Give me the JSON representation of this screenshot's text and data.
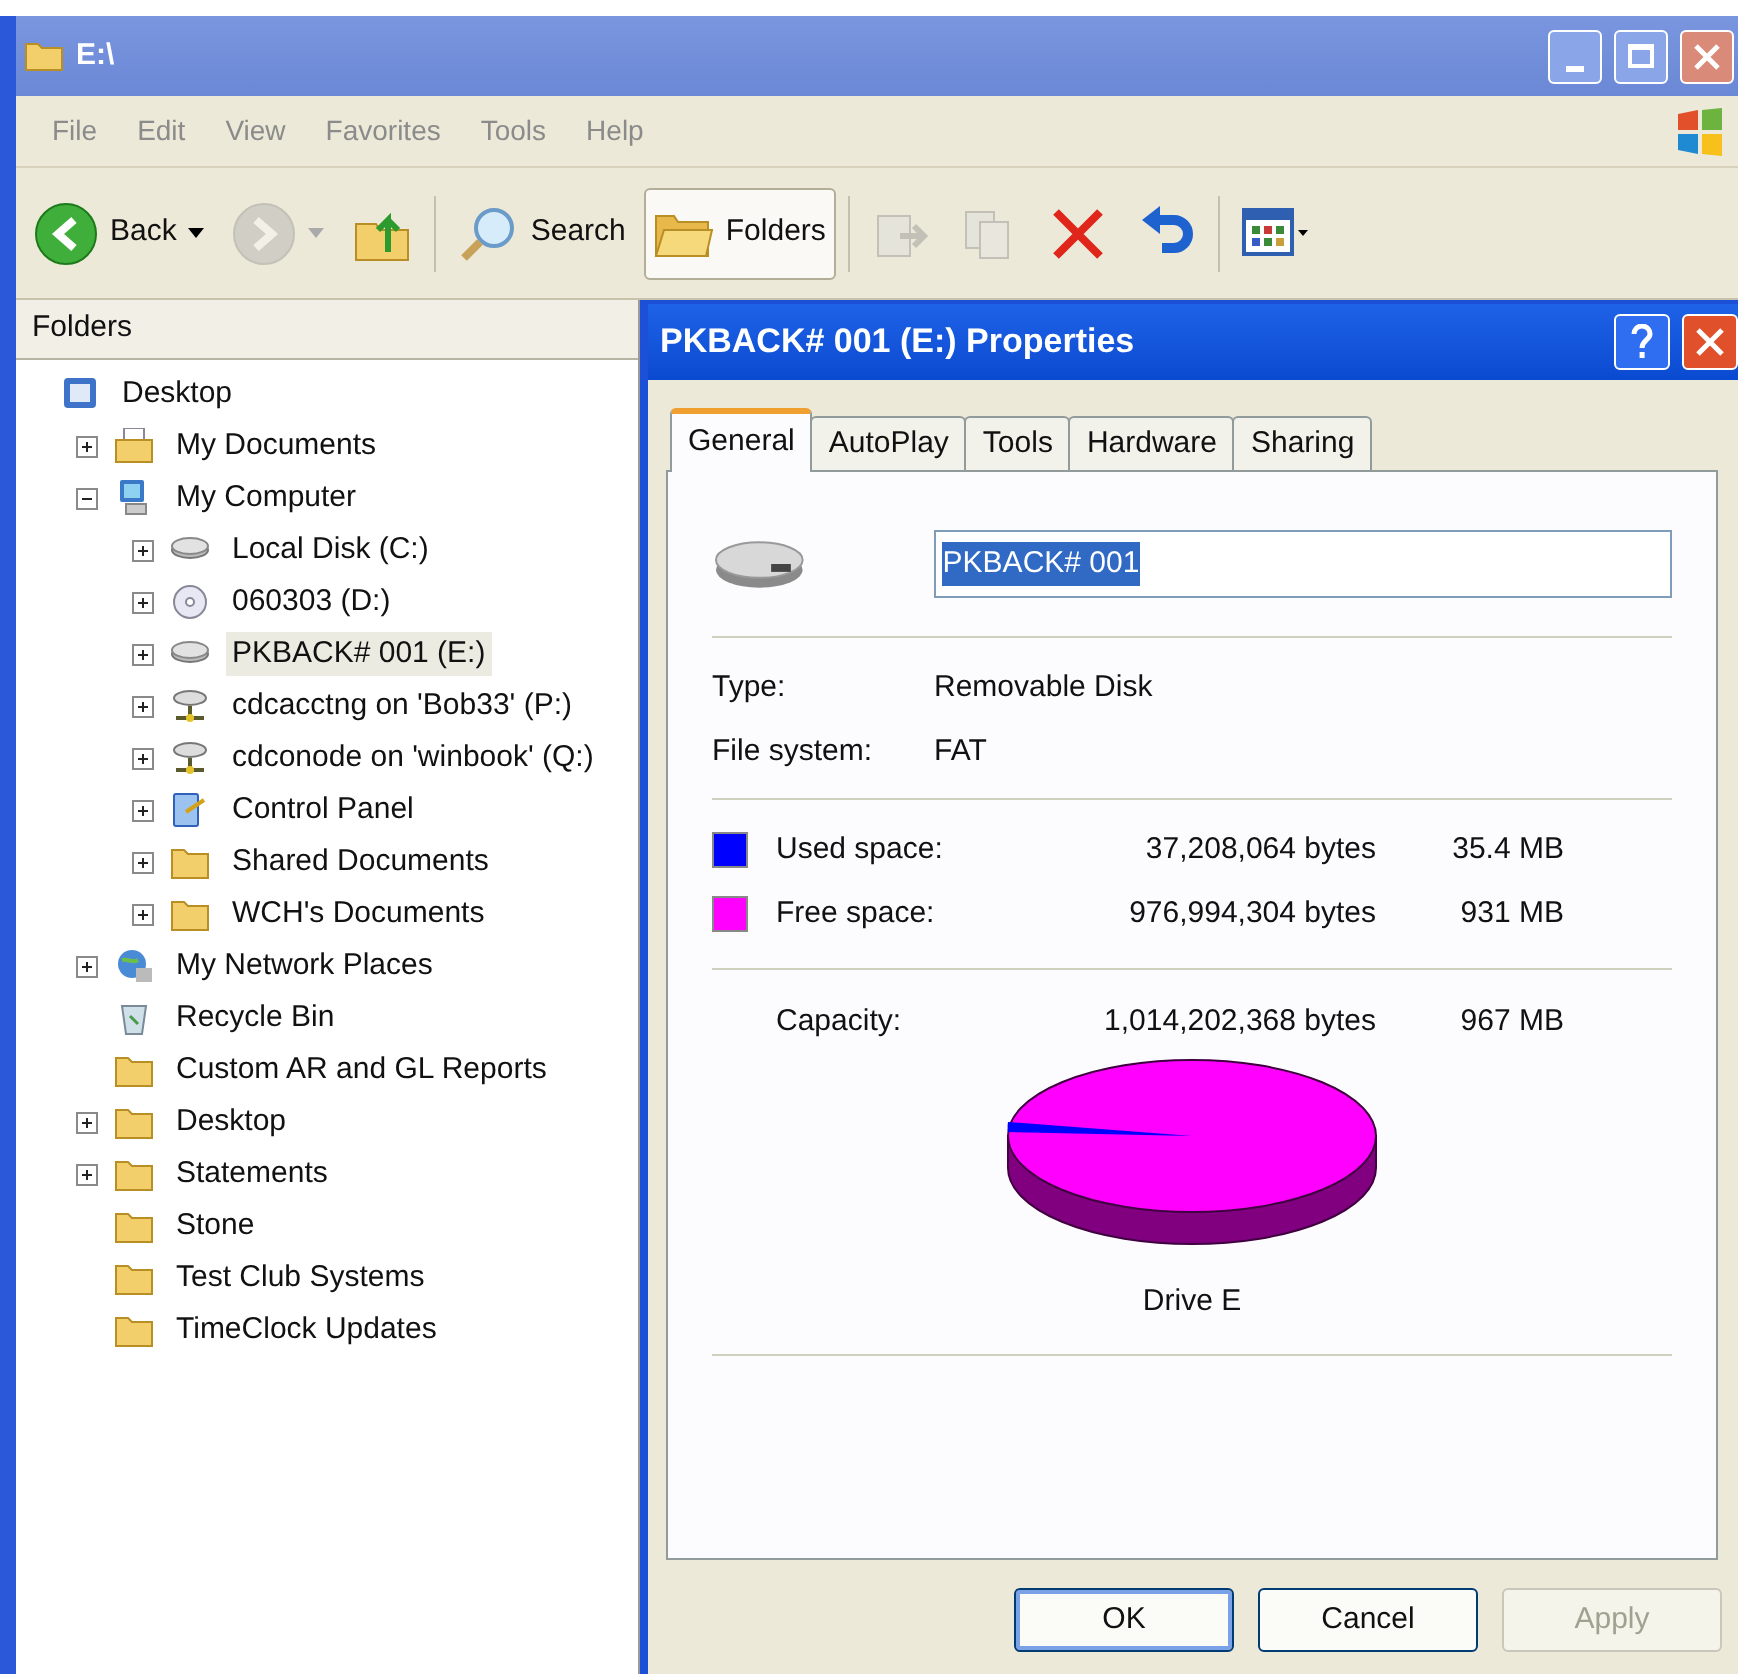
{
  "window": {
    "title": "E:\\"
  },
  "menu": [
    "File",
    "Edit",
    "View",
    "Favorites",
    "Tools",
    "Help"
  ],
  "toolbar": [
    {
      "kind": "back",
      "label": "Back",
      "disabled": false,
      "selected": false
    },
    {
      "kind": "forward",
      "disabled": true,
      "selected": false
    },
    {
      "kind": "up",
      "disabled": false,
      "selected": false
    },
    {
      "kind": "search",
      "label": "Search",
      "disabled": false,
      "selected": false
    },
    {
      "kind": "folders",
      "label": "Folders",
      "disabled": false,
      "selected": true
    },
    {
      "kind": "moveto",
      "disabled": true,
      "selected": false
    },
    {
      "kind": "copyto",
      "disabled": true,
      "selected": false
    },
    {
      "kind": "delete",
      "disabled": false,
      "selected": false
    },
    {
      "kind": "undo",
      "disabled": false,
      "selected": false
    },
    {
      "kind": "views",
      "disabled": false,
      "selected": false
    }
  ],
  "folders_pane": {
    "title": "Folders",
    "tree": [
      {
        "label": "Desktop",
        "kind": "desktop",
        "selected": false,
        "children": [
          {
            "label": "My Documents",
            "kind": "documents",
            "expanded": false,
            "selected": false
          },
          {
            "label": "My Computer",
            "kind": "computer",
            "expanded": true,
            "selected": false,
            "children": [
              {
                "label": "Local Disk (C:)",
                "kind": "drive",
                "expanded": false,
                "selected": false
              },
              {
                "label": "060303 (D:)",
                "kind": "cd",
                "expanded": false,
                "selected": false
              },
              {
                "label": "PKBACK# 001 (E:)",
                "kind": "drive",
                "expanded": false,
                "selected": true
              },
              {
                "label": "cdcacctng on 'Bob33' (P:)",
                "kind": "netdrive",
                "expanded": false,
                "selected": false
              },
              {
                "label": "cdconode on 'winbook' (Q:)",
                "kind": "netdrive",
                "expanded": false,
                "selected": false
              },
              {
                "label": "Control Panel",
                "kind": "control",
                "expanded": false,
                "selected": false
              },
              {
                "label": "Shared Documents",
                "kind": "folder",
                "expanded": false,
                "selected": false
              },
              {
                "label": "WCH's Documents",
                "kind": "folder",
                "expanded": false,
                "selected": false
              }
            ]
          },
          {
            "label": "My Network Places",
            "kind": "network",
            "expanded": false,
            "selected": false
          },
          {
            "label": "Recycle Bin",
            "kind": "recycle",
            "selected": false
          },
          {
            "label": "Custom AR and GL Reports",
            "kind": "folder",
            "selected": false
          },
          {
            "label": "Desktop",
            "kind": "folder",
            "expanded": false,
            "selected": false
          },
          {
            "label": "Statements",
            "kind": "folder",
            "expanded": false,
            "selected": false
          },
          {
            "label": "Stone",
            "kind": "folder",
            "selected": false
          },
          {
            "label": "Test Club Systems",
            "kind": "folder",
            "selected": false
          },
          {
            "label": "TimeClock Updates",
            "kind": "folder",
            "selected": false
          }
        ]
      }
    ]
  },
  "dialog": {
    "title": "PKBACK# 001 (E:) Properties",
    "tabs": [
      {
        "label": "General",
        "selected": true
      },
      {
        "label": "AutoPlay",
        "selected": false
      },
      {
        "label": "Tools",
        "selected": false
      },
      {
        "label": "Hardware",
        "selected": false
      },
      {
        "label": "Sharing",
        "selected": false
      }
    ],
    "name_field": {
      "value": "PKBACK# 001",
      "highlighted": true
    },
    "info": [
      {
        "label": "Type:",
        "value": "Removable Disk"
      },
      {
        "label": "File system:",
        "value": "FAT"
      }
    ],
    "space": [
      {
        "label": "Used space:",
        "bytes": "37,208,064 bytes",
        "size": "35.4 MB",
        "color": "#0000ff"
      },
      {
        "label": "Free space:",
        "bytes": "976,994,304 bytes",
        "size": "931 MB",
        "color": "#ff00ff"
      }
    ],
    "capacity": {
      "label": "Capacity:",
      "bytes": "1,014,202,368 bytes",
      "size": "967 MB"
    },
    "chart_caption": "Drive E",
    "buttons": [
      {
        "label": "OK",
        "disabled": false,
        "default": true
      },
      {
        "label": "Cancel",
        "disabled": false,
        "default": false
      },
      {
        "label": "Apply",
        "disabled": true,
        "default": false
      }
    ]
  }
}
